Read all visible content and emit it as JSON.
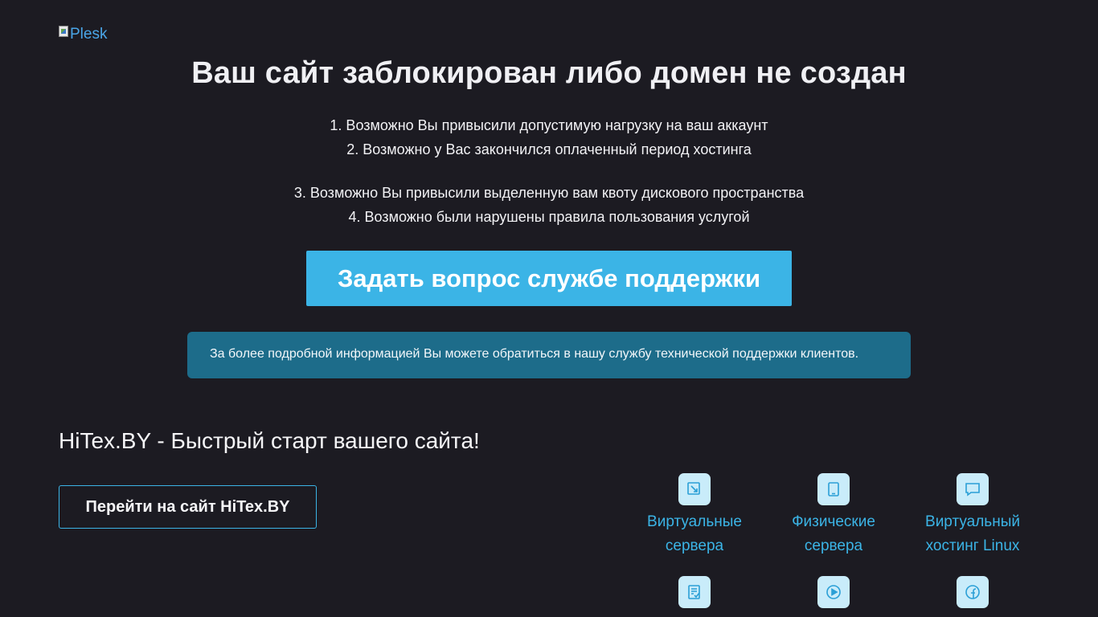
{
  "logo": {
    "alt": "Plesk"
  },
  "title": "Ваш сайт заблокирован либо домен не создан",
  "reasons": [
    "1. Возможно Вы привысили допустимую нагрузку на ваш аккаунт",
    "2. Возможно у Вас закончился оплаченный период хостинга",
    "3. Возможно Вы привысили выделенную вам квоту дискового пространства",
    "4. Возможно были нарушены правила пользования услугой"
  ],
  "support_button": "Задать вопрос службе поддержки",
  "info_text": "За более подробной информацией Вы можете обратиться в нашу службу технической поддержки клиентов.",
  "slogan": "HiTex.BY - Быстрый старт вашего сайта!",
  "site_button": "Перейти на сайт HiTex.BY",
  "services": [
    {
      "line1": "Виртуальные",
      "line2": "сервера",
      "icon": "edit-window-icon"
    },
    {
      "line1": "Физические",
      "line2": "сервера",
      "icon": "tablet-icon"
    },
    {
      "line1": "Виртуальный",
      "line2": "хостинг Linux",
      "icon": "chat-bubble-icon"
    },
    {
      "line1": "",
      "line2": "",
      "icon": "checklist-icon"
    },
    {
      "line1": "",
      "line2": "",
      "icon": "play-circle-icon"
    },
    {
      "line1": "",
      "line2": "",
      "icon": "facebook-icon"
    }
  ],
  "colors": {
    "background": "#1c1b22",
    "accent": "#3bb4e6",
    "info_box": "#1d6c8a",
    "icon_bg": "#c9ecfa"
  }
}
